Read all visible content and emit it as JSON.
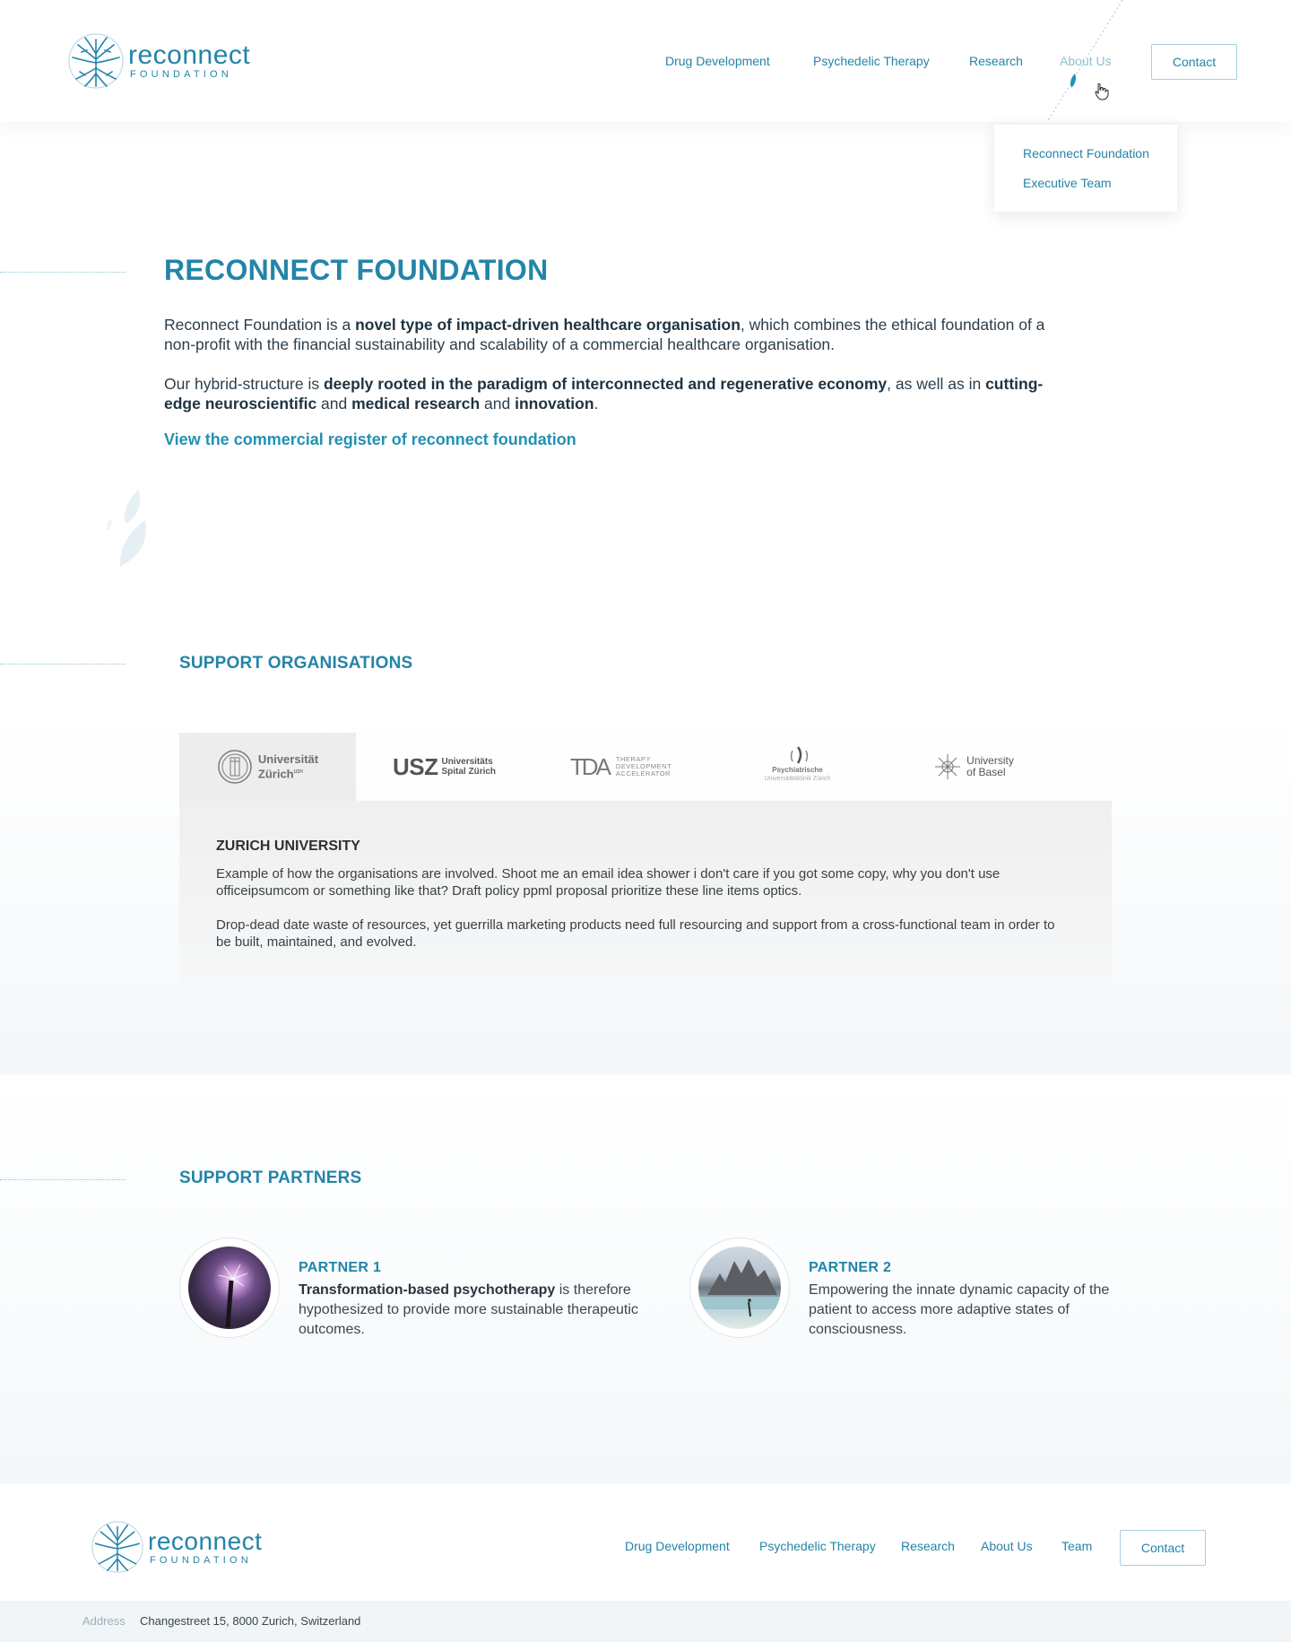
{
  "brand": {
    "name": "reconnect",
    "sub": "FOUNDATION",
    "accent": "#2384a8"
  },
  "nav": {
    "items": [
      "Drug Development",
      "Psychedelic Therapy",
      "Research",
      "About Us"
    ],
    "contact": "Contact",
    "dropdown": [
      "Reconnect Foundation",
      "Executive Team"
    ]
  },
  "hero": {
    "title": "RECONNECT FOUNDATION",
    "p1": {
      "a": "Reconnect Foundation is a ",
      "b": "novel type of impact-driven healthcare organisation",
      "c": ", which combines the ethical foundation of a non-profit with the financial sustainability and scalability of a commercial healthcare organisation."
    },
    "p2": {
      "a": "Our hybrid-structure is ",
      "b": "deeply rooted in the paradigm of interconnected and regenerative economy",
      "c": ", as well as in ",
      "d": "cutting-edge neuroscientific",
      "e": " and ",
      "f": "medical research",
      "g": " and ",
      "h": "innovation",
      "i": "."
    },
    "link": "View the commercial register of reconnect foundation"
  },
  "organisations": {
    "title": "SUPPORT ORGANISATIONS",
    "logos": [
      {
        "line1": "Universität",
        "line2": "Zürich",
        "sup": "UZH"
      },
      {
        "big": "USZ",
        "line1": "Universitäts",
        "line2": "Spital Zürich"
      },
      {
        "big": "TDA",
        "line1": "THERAPY",
        "line2": "DEVELOPMENT",
        "line3": "ACCELERATOR"
      },
      {
        "line1": "Psychiatrische",
        "line2": "Universitätsklinik Zürich"
      },
      {
        "line1": "University",
        "line2": "of Basel"
      }
    ],
    "selected": {
      "name": "ZURICH UNIVERSITY",
      "p1": "Example of how the organisations are involved. Shoot me an email idea shower i don't care if you got some copy, why you don't use officeipsumcom or something like that? Draft policy ppml proposal prioritize these line items optics.",
      "p2": "Drop-dead date waste of resources, yet guerrilla marketing products need full resourcing and support from a cross-functional team in order to be built, maintained, and evolved."
    }
  },
  "partners": {
    "title": "SUPPORT PARTNERS",
    "items": [
      {
        "title": "PARTNER 1",
        "bold": "Transformation-based psychotherapy",
        "text": " is therefore hypothesized to provide more sustainable therapeutic outcomes."
      },
      {
        "title": "PARTNER 2",
        "bold": "",
        "text": "Empowering the innate dynamic capacity of the patient to access more adaptive states of consciousness."
      }
    ]
  },
  "footer": {
    "nav": [
      "Drug Development",
      "Psychedelic Therapy",
      "Research",
      "About Us",
      "Team"
    ],
    "contact": "Contact",
    "address_label": "Address",
    "address": "Changestreet 15, 8000 Zurich, Switzerland"
  }
}
